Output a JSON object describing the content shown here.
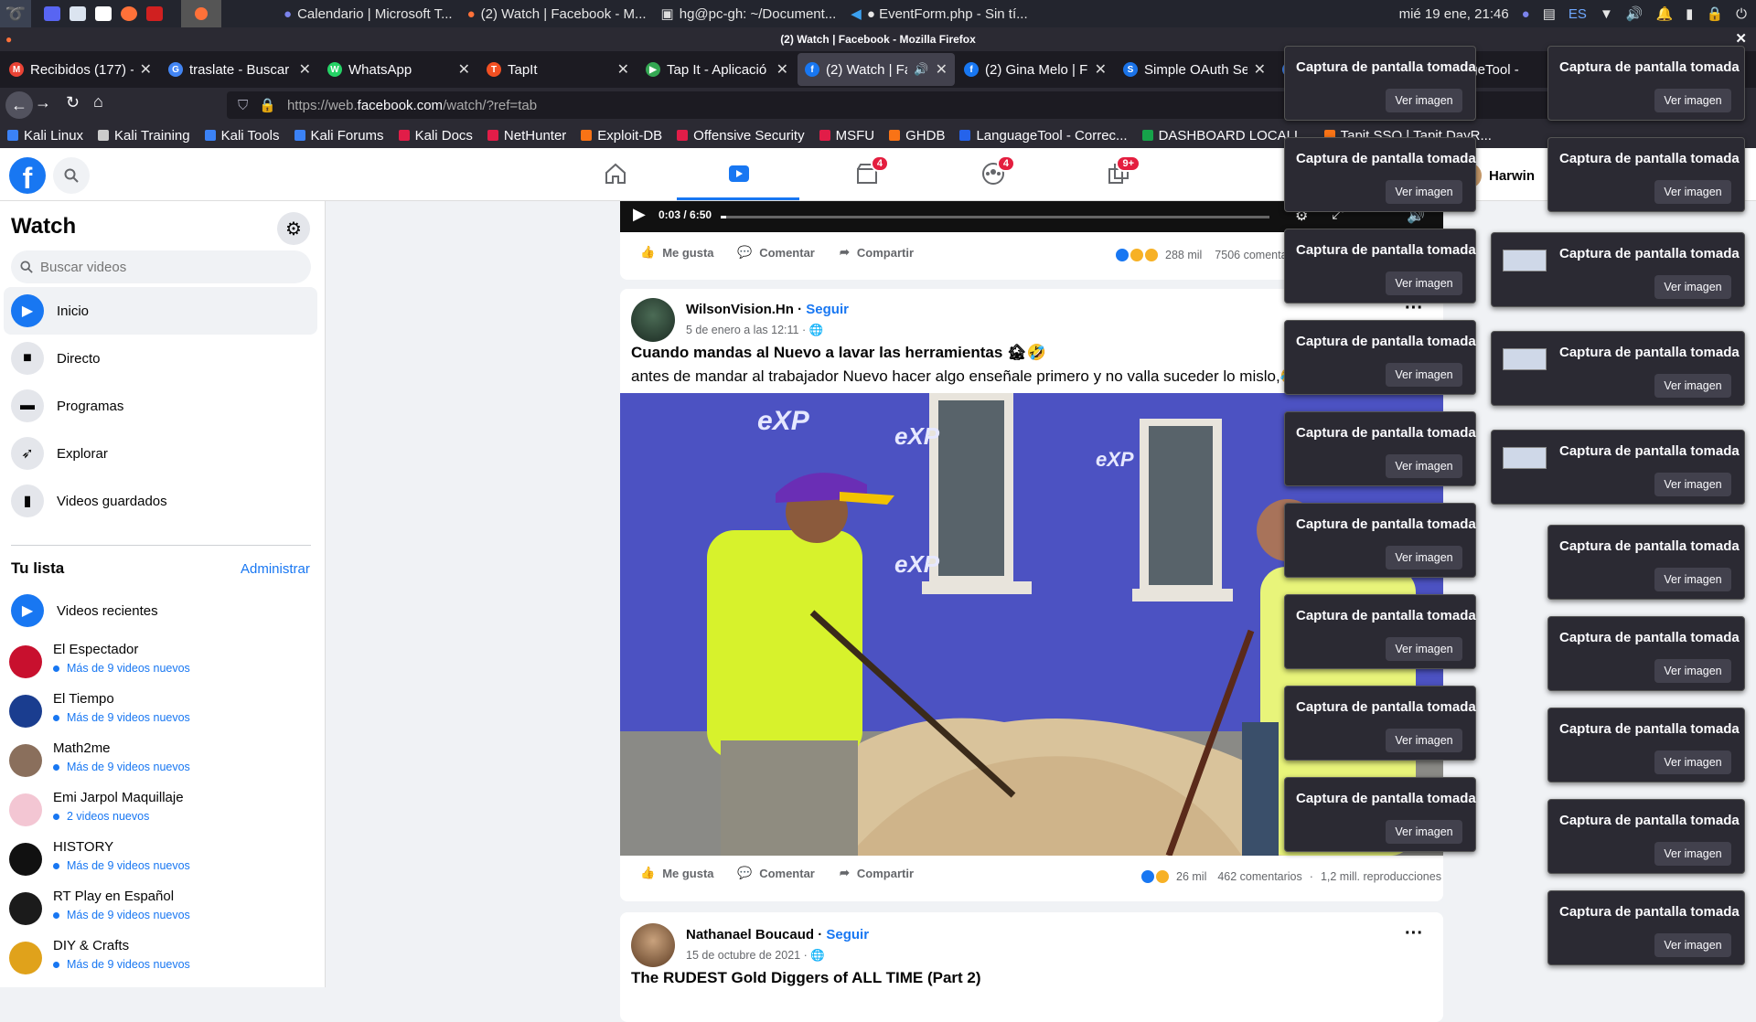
{
  "os_panel": {
    "tasks": [
      {
        "icon": "teams-icon",
        "label": "Calendario | Microsoft T..."
      },
      {
        "icon": "firefox-icon",
        "label": "(2) Watch | Facebook - M..."
      },
      {
        "icon": "terminal-icon",
        "label": "hg@pc-gh: ~/Document..."
      },
      {
        "icon": "vscode-icon",
        "label": "● EventForm.php - Sin tí..."
      }
    ],
    "datetime": "mié 19 ene, 21:46",
    "keyboard_layout": "ES"
  },
  "window_title": "(2) Watch | Facebook - Mozilla Firefox",
  "tabs": [
    {
      "label": "Recibidos (177) -",
      "icon_color": "#ea4335",
      "icon_text": "M"
    },
    {
      "label": "traslate - Buscar",
      "icon_color": "#4285f4",
      "icon_text": "G"
    },
    {
      "label": "WhatsApp",
      "icon_color": "#25d366",
      "icon_text": "W"
    },
    {
      "label": "TapIt",
      "icon_color": "#f25022",
      "icon_text": "T"
    },
    {
      "label": "Tap It - Aplicació",
      "icon_color": "#34a853",
      "icon_text": "▶"
    },
    {
      "label": "(2) Watch | Fa",
      "icon_color": "#1877f2",
      "icon_text": "f"
    },
    {
      "label": "(2) Gina Melo | F",
      "icon_color": "#1877f2",
      "icon_text": "f"
    },
    {
      "label": "Simple OAuth Se",
      "icon_color": "#1a73e8",
      "icon_text": "S"
    },
    {
      "label": "t",
      "icon_color": "#4285f4",
      "icon_text": "G"
    },
    {
      "label": "ageTool -",
      "icon_color": "#333",
      "icon_text": ""
    }
  ],
  "url": {
    "prefix": "https://web.",
    "domain": "facebook.com",
    "path": "/watch/?ref=tab"
  },
  "bookmarks": [
    {
      "label": "Kali Linux",
      "color": "#3b82f6"
    },
    {
      "label": "Kali Training",
      "color": "#cccccc"
    },
    {
      "label": "Kali Tools",
      "color": "#3b82f6"
    },
    {
      "label": "Kali Forums",
      "color": "#3b82f6"
    },
    {
      "label": "Kali Docs",
      "color": "#e11d48"
    },
    {
      "label": "NetHunter",
      "color": "#e11d48"
    },
    {
      "label": "Exploit-DB",
      "color": "#f97316"
    },
    {
      "label": "Offensive Security",
      "color": "#e11d48"
    },
    {
      "label": "MSFU",
      "color": "#e11d48"
    },
    {
      "label": "GHDB",
      "color": "#f97316"
    },
    {
      "label": "LanguageTool - Correc...",
      "color": "#2563eb"
    },
    {
      "label": "DASHBOARD LOCALI...",
      "color": "#16a34a"
    },
    {
      "label": "Tapit SSO | Tapit DayR...",
      "color": "#f97316"
    }
  ],
  "fb_header": {
    "badges": {
      "watch": "",
      "marketplace": "4",
      "groups": "4",
      "gaming": "9+"
    },
    "profile_name": "Harwin"
  },
  "sidebar": {
    "title": "Watch",
    "search_placeholder": "Buscar videos",
    "nav": [
      {
        "label": "Inicio",
        "icon": "play-icon"
      },
      {
        "label": "Directo",
        "icon": "live-camera-icon"
      },
      {
        "label": "Programas",
        "icon": "clapper-icon"
      },
      {
        "label": "Explorar",
        "icon": "rocket-icon"
      },
      {
        "label": "Videos guardados",
        "icon": "bookmark-icon"
      }
    ],
    "list_title": "Tu lista",
    "manage_label": "Administrar",
    "recent_label": "Videos recientes",
    "channels": [
      {
        "name": "El Espectador",
        "sub": "Más de 9 videos nuevos",
        "avatar_color": "#c8102e"
      },
      {
        "name": "El Tiempo",
        "sub": "Más de 9 videos nuevos",
        "avatar_color": "#1a3d8f"
      },
      {
        "name": "Math2me",
        "sub": "Más de 9 videos nuevos",
        "avatar_color": "#8a6f5c"
      },
      {
        "name": "Emi Jarpol Maquillaje",
        "sub": "2 videos nuevos",
        "avatar_color": "#f3c6d3"
      },
      {
        "name": "HISTORY",
        "sub": "Más de 9 videos nuevos",
        "avatar_color": "#111111"
      },
      {
        "name": "RT Play en Español",
        "sub": "Más de 9 videos nuevos",
        "avatar_color": "#1b1b1b"
      },
      {
        "name": "DIY & Crafts",
        "sub": "Más de 9 videos nuevos",
        "avatar_color": "#e0a21b"
      }
    ]
  },
  "video_top": {
    "time": "0:03 / 6:50",
    "progress": 0.01,
    "like": "Me gusta",
    "comment": "Comentar",
    "share": "Compartir",
    "reactions": "288 mil",
    "comments": "7506 comenta"
  },
  "post1": {
    "author": "WilsonVision.Hn",
    "follow": "Seguir",
    "date": "5 de enero a las 12:11 ·",
    "title": "Cuando mandas al Nuevo a lavar las herramientas 🏚🤣",
    "description": "antes de mandar al trabajador Nuevo hacer algo enseñale primero y no valla suceder lo mislo,😂🤷🤷",
    "like": "Me gusta",
    "comment": "Comentar",
    "share": "Compartir",
    "reactions": "26 mil",
    "comments": "462 comentarios",
    "views": "1,2 mill. reproducciones",
    "wall_text": "eXP"
  },
  "post2": {
    "author": "Nathanael Boucaud",
    "follow": "Seguir",
    "date": "15 de octubre de 2021 ·",
    "title": "The RUDEST Gold Diggers of ALL TIME (Part 2)"
  },
  "notifications": {
    "title": "Captura de pantalla tomada",
    "button": "Ver imagen"
  }
}
